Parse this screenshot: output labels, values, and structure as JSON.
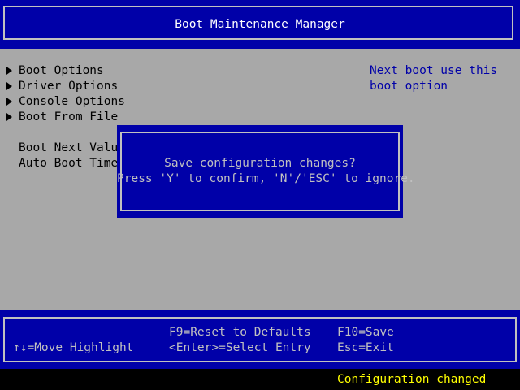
{
  "header": {
    "title": "Boot Maintenance Manager"
  },
  "menu": {
    "items": [
      {
        "label": "Boot Options"
      },
      {
        "label": "Driver Options"
      },
      {
        "label": "Console Options"
      },
      {
        "label": "Boot From File"
      }
    ],
    "fields": [
      {
        "label": "Boot Next Value"
      },
      {
        "label": "Auto Boot Time-"
      }
    ]
  },
  "help": {
    "lines": [
      "Next boot use this",
      "boot option"
    ]
  },
  "dialog": {
    "line1": "Save configuration changes?",
    "line2": "Press 'Y' to confirm, 'N'/'ESC' to ignore."
  },
  "footer": {
    "move_highlight": "↑↓=Move Highlight",
    "reset_defaults": "F9=Reset to Defaults",
    "select_entry": "<Enter>=Select Entry",
    "save": "F10=Save",
    "exit": "Esc=Exit"
  },
  "status": {
    "text": "Configuration changed"
  },
  "colors": {
    "background": "#a8a8a8",
    "frame_blue": "#0000a8",
    "help_text": "#0000a8",
    "status_text": "#ffff00"
  }
}
